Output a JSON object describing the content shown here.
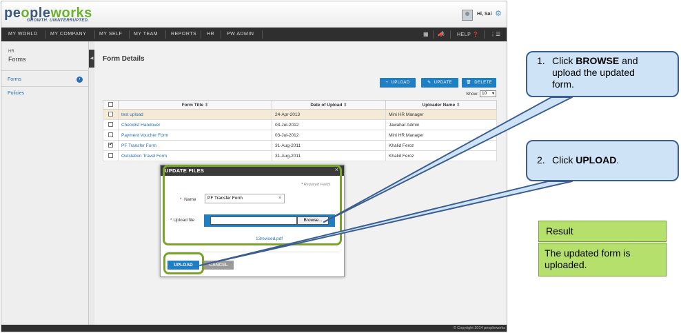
{
  "app": {
    "logo": {
      "part1": "pe",
      "o": "o",
      "part2": "ple",
      "part3": "works",
      "tagline": "GROWTH. UNINTERRUPTED."
    },
    "user_greeting": "Hi, Sai",
    "settings_icon": "gear-icon",
    "nav": {
      "items": [
        "MY WORLD",
        "MY COMPANY",
        "MY SELF",
        "MY TEAM",
        "REPORTS",
        "HR",
        "PW ADMIN"
      ],
      "help": "HELP"
    },
    "sidebar": {
      "section": "HR",
      "title": "Forms",
      "items": [
        "Forms",
        "Policies"
      ]
    },
    "main": {
      "page_title": "Form Details",
      "buttons": {
        "upload": "UPLOAD",
        "update": "UPDATE",
        "delete": "DELETE"
      },
      "show_label": "Show:",
      "show_value": "10",
      "columns": [
        "Form Title",
        "Date of Upload",
        "Uploader Name"
      ],
      "rows": [
        {
          "title": "test upload",
          "date": "24-Apr-2013",
          "uploader": "Mini HR Manager",
          "checked": false
        },
        {
          "title": "Checklist Handover",
          "date": "03-Jul-2012",
          "uploader": "Jawahar Admin",
          "checked": false
        },
        {
          "title": "Payment Voucher Form",
          "date": "03-Jul-2012",
          "uploader": "Mini HR Manager",
          "checked": false
        },
        {
          "title": "PF Transfer Form",
          "date": "31-Aug-2011",
          "uploader": "Khalid Feroz",
          "checked": true
        },
        {
          "title": "Outstation Travel Form",
          "date": "31-Aug-2011",
          "uploader": "Khalid Feroz",
          "checked": false
        }
      ]
    },
    "modal": {
      "title": "UPDATE FILES",
      "required_note": "Required Fields",
      "name_label": "Name",
      "name_value": "PF Transfer Form",
      "upload_label": "Upload file",
      "browse_label": "Browse...",
      "file_link": "13revised.pdf",
      "upload_button": "UPLOAD",
      "cancel_button": "CANCEL"
    },
    "footer": {
      "copyright": "© Copyright 2014 peopleworks"
    }
  },
  "annotations": {
    "step1": {
      "number": "1.",
      "pre": "Click ",
      "bold": "BROWSE",
      "post": " and",
      "line2": "upload the updated",
      "line3": "form."
    },
    "step2": {
      "number": "2.",
      "pre": "Click ",
      "bold": "UPLOAD",
      "post": "."
    },
    "result_title": "Result",
    "result_text": "The updated  form is uploaded."
  },
  "colors": {
    "accent_blue": "#1f7fc4",
    "highlight_green": "#79a329",
    "callout_fill": "#cfe3f6",
    "result_fill": "#b6e06c"
  }
}
